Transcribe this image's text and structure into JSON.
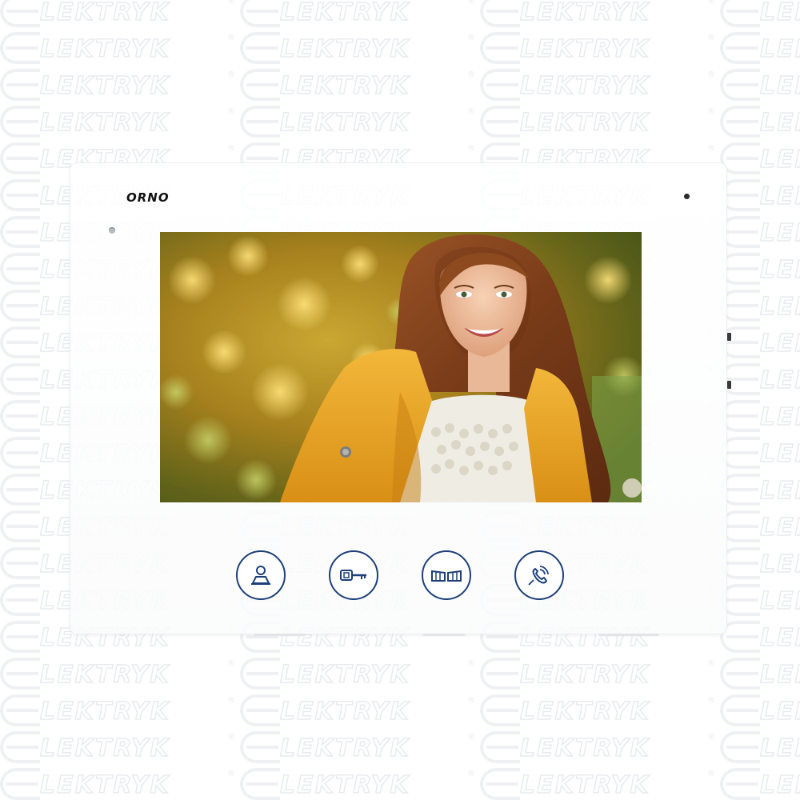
{
  "watermark": {
    "text": "LEKTRYK",
    "registered_mark": "®"
  },
  "device": {
    "brand": "ORNO"
  },
  "screen": {
    "image": "smiling woman with long auburn hair in a yellow coat, autumn foliage background"
  },
  "buttons": [
    {
      "icon": "person-icon"
    },
    {
      "icon": "key-icon"
    },
    {
      "icon": "gate-icon"
    },
    {
      "icon": "phone-icon"
    }
  ],
  "colors": {
    "button_accent": "#1c3f7a",
    "watermark": "#e8ebef",
    "device_body": "#ffffff"
  }
}
